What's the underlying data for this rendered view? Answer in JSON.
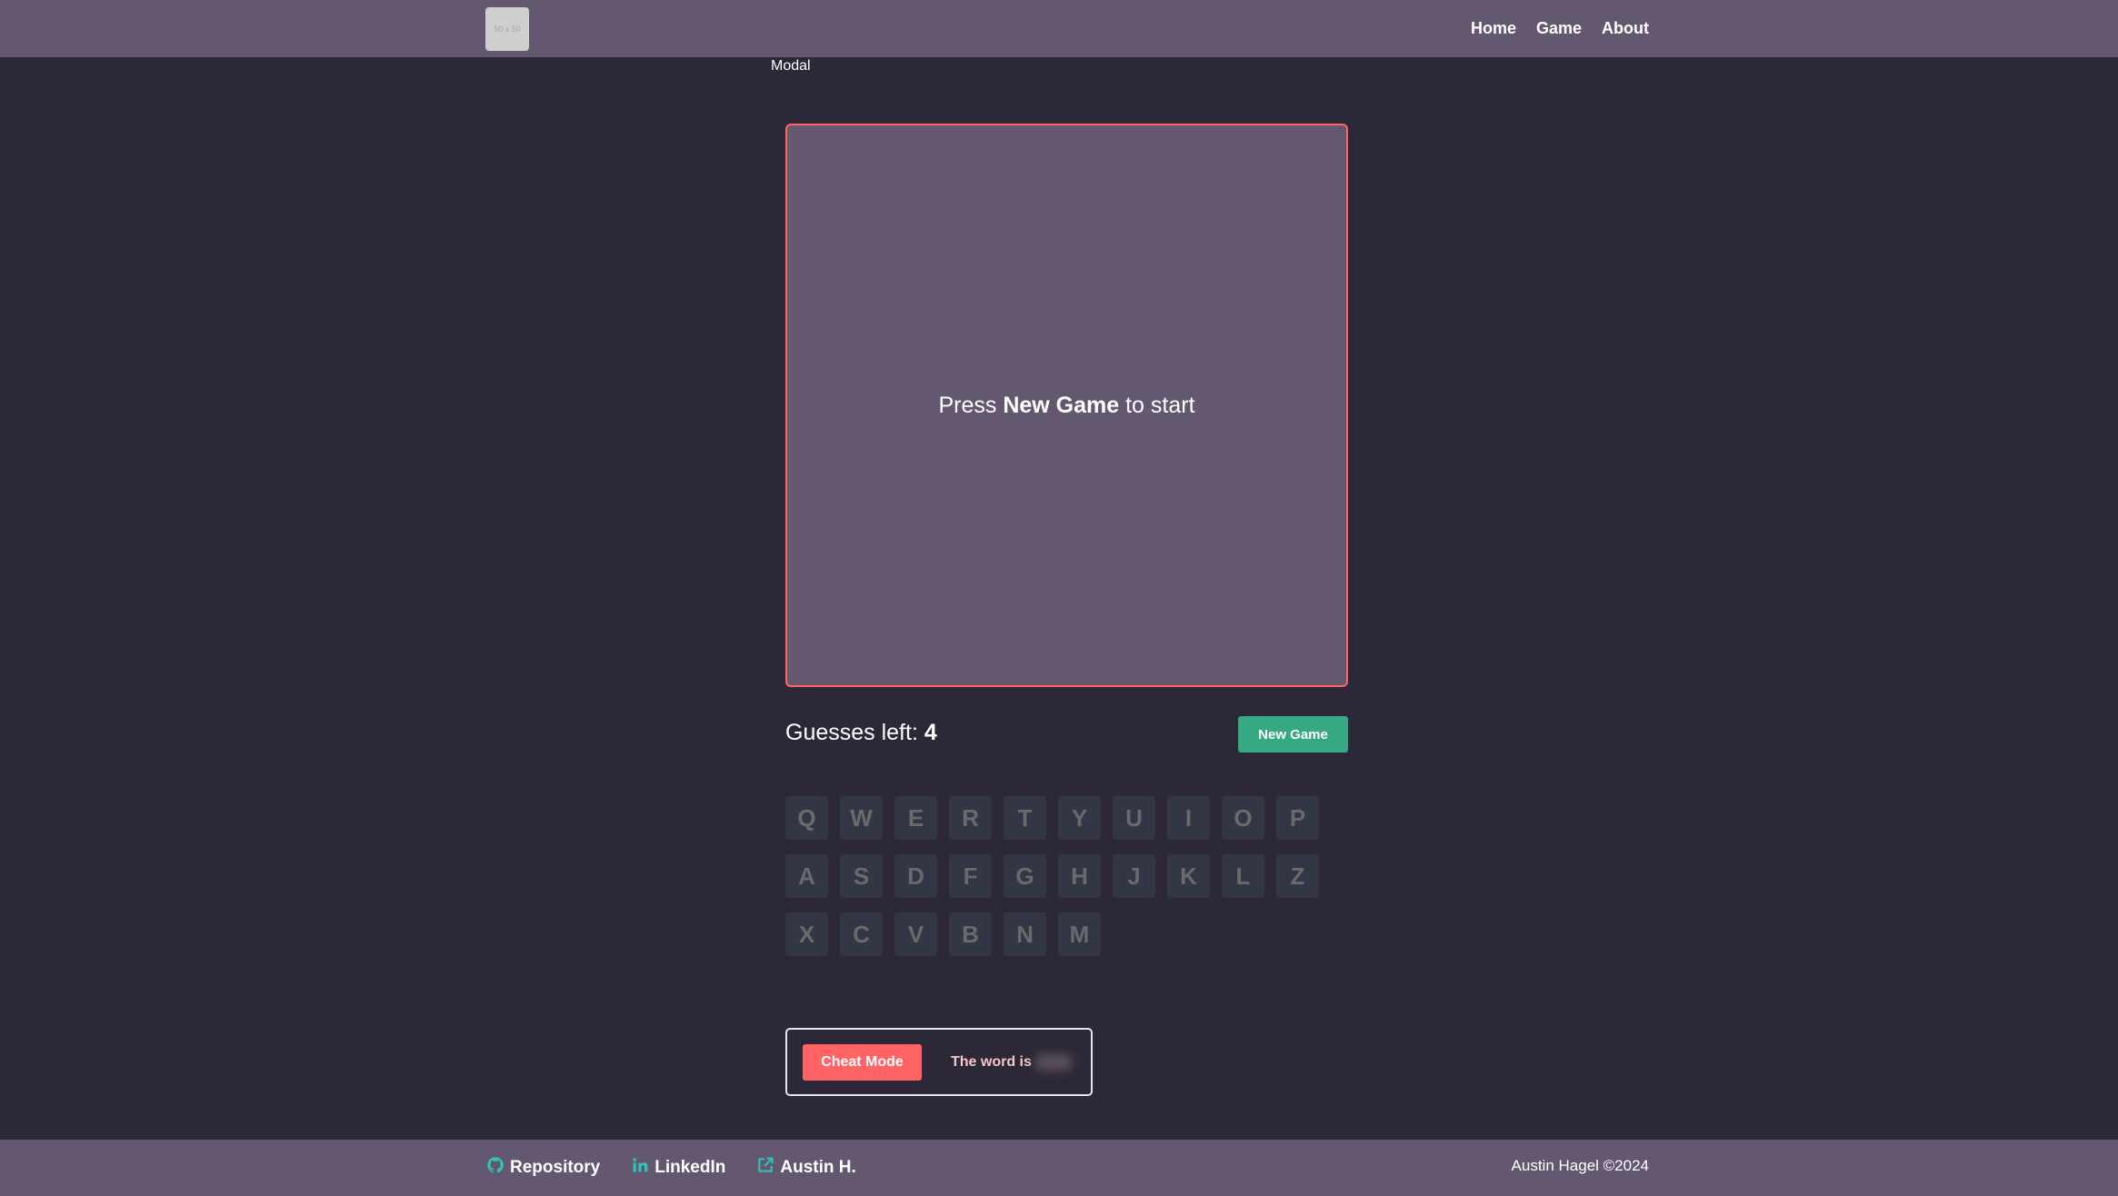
{
  "nav": {
    "logo_text": "50 x 50",
    "links": [
      "Home",
      "Game",
      "About"
    ]
  },
  "modal_label": "Modal",
  "board": {
    "message_prefix": "Press ",
    "message_bold": "New Game",
    "message_suffix": " to start",
    "border_color": "#ff6363"
  },
  "status": {
    "guesses_label": "Guesses left: ",
    "guesses_left": "4"
  },
  "buttons": {
    "new_game": "New Game",
    "cheat_mode": "Cheat Mode"
  },
  "keyboard": {
    "rows": [
      [
        "Q",
        "W",
        "E",
        "R",
        "T",
        "Y",
        "U",
        "I",
        "O",
        "P"
      ],
      [
        "A",
        "S",
        "D",
        "F",
        "G",
        "H",
        "J",
        "K",
        "L",
        "Z"
      ],
      [
        "X",
        "C",
        "V",
        "B",
        "N",
        "M"
      ]
    ]
  },
  "cheat": {
    "word_label": "The word is"
  },
  "footer": {
    "links": [
      {
        "label": "Repository",
        "icon": "github-icon"
      },
      {
        "label": "LinkedIn",
        "icon": "linkedin-icon"
      },
      {
        "label": "Austin H.",
        "icon": "external-link-icon"
      }
    ],
    "copyright": "Austin Hagel ©2024"
  },
  "colors": {
    "accent_green": "#37a884",
    "accent_red": "#ff6363",
    "icon_teal": "#2ec4b6"
  }
}
